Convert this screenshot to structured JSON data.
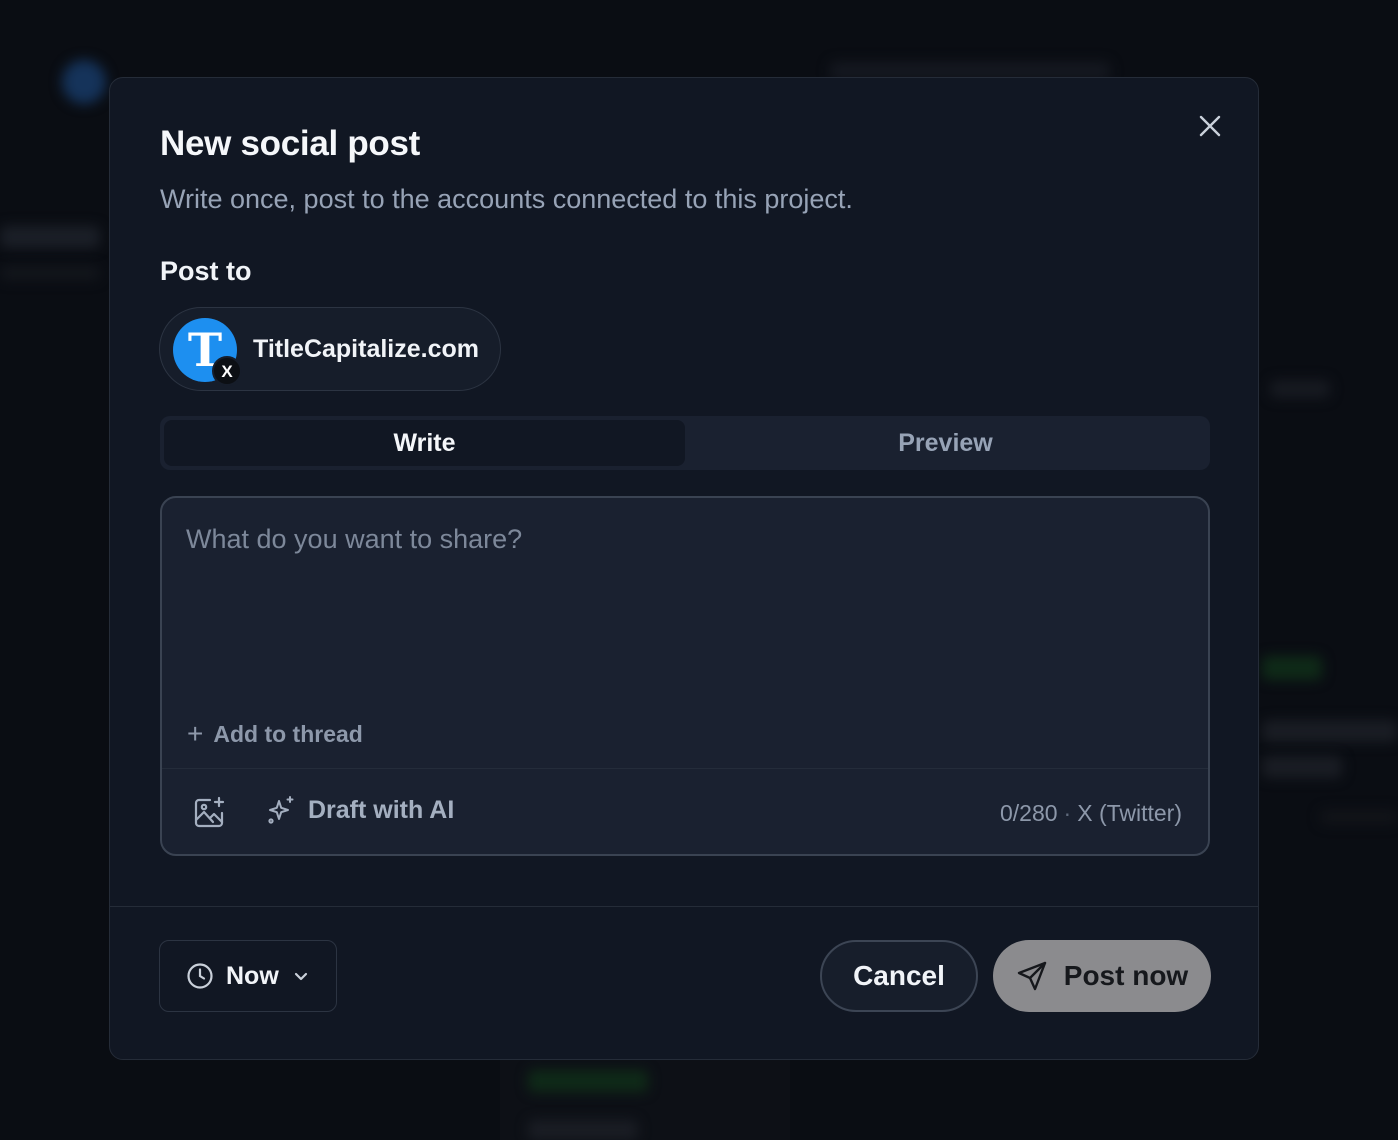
{
  "modal": {
    "title": "New social post",
    "subtitle": "Write once, post to the accounts connected to this project.",
    "post_to_label": "Post to",
    "close_icon": "close-icon"
  },
  "account": {
    "name": "TitleCapitalize.com",
    "avatar_letter": "T",
    "platform_badge": "X",
    "avatar_color": "#1d8ff0"
  },
  "tabs": [
    {
      "label": "Write",
      "active": true
    },
    {
      "label": "Preview",
      "active": false
    }
  ],
  "editor": {
    "placeholder": "What do you want to share?",
    "value": "",
    "add_thread_label": "Add to thread",
    "draft_ai_label": "Draft with AI",
    "counter": "0/280",
    "counter_separator": "·",
    "platform_name": "X (Twitter)"
  },
  "footer": {
    "schedule_label": "Now",
    "cancel_label": "Cancel",
    "post_label": "Post now"
  },
  "colors": {
    "modal_bg": "#111723",
    "post_button_bg": "#8b8b8e",
    "x_accent": "#1d8ff0"
  }
}
